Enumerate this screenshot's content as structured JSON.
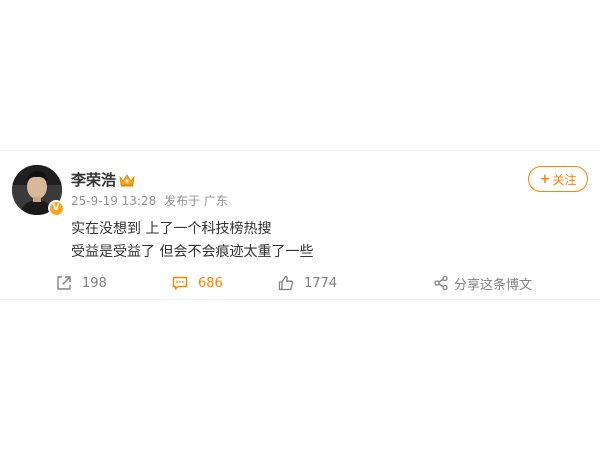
{
  "post": {
    "author": {
      "name": "李荣浩",
      "verified_badge": "V",
      "crown_icon": "crown-icon"
    },
    "meta": {
      "timestamp": "25-9-19 13:28",
      "location": "发布于 广东"
    },
    "follow_button": {
      "label": "关注"
    },
    "content": {
      "line1": "实在没想到 上了一个科技榜热搜",
      "line2": "受益是受益了 但会不会痕迹太重了一些"
    },
    "actions": {
      "repost_count": "198",
      "comment_count": "686",
      "like_count": "1774",
      "share_label": "分享这条博文"
    }
  },
  "colors": {
    "accent": "#ff8200",
    "text": "#333333",
    "muted": "#939393",
    "icon": "#808080"
  }
}
